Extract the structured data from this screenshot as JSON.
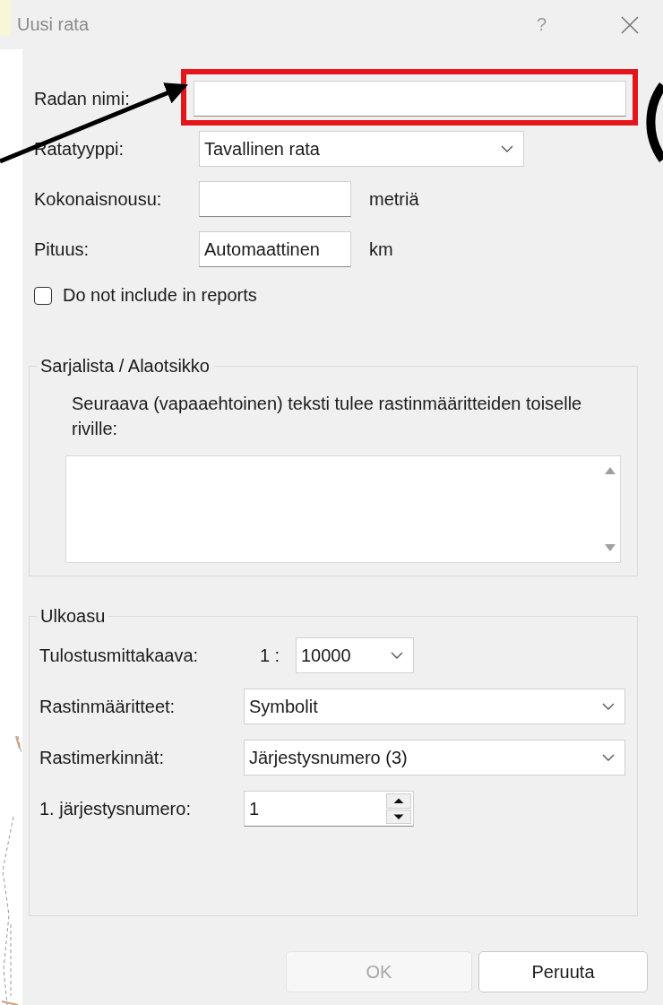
{
  "window": {
    "title": "Uusi rata",
    "help": "?"
  },
  "fields": [
    {
      "kind": "text",
      "label": "Radan nimi:",
      "highlighted": true
    },
    {
      "kind": "dropdown",
      "label": "Ratatyyppi:",
      "value": "Tavallinen rata",
      "highlighted": false
    },
    {
      "kind": "text",
      "label": "Kokonaisnousu:",
      "unit": "metriä",
      "highlighted": false
    },
    {
      "kind": "text",
      "label": "Pituus:",
      "value": "Automaattinen",
      "unit": "km",
      "highlighted": false
    }
  ],
  "exclude_checkbox": {
    "label": "Do not include in reports",
    "checked": false
  },
  "subtitle_group": {
    "title": "Sarjalista / Alaotsikko",
    "description": "Seuraava (vapaaehtoinen) teksti tulee rastinmääritteiden toiselle riville:"
  },
  "layout_group": {
    "title": "Ulkoasu",
    "rows": [
      {
        "kind": "scale",
        "label": "Tulostusmittakaava:",
        "prefix": "1 :",
        "value": "10000"
      },
      {
        "kind": "dropdown",
        "label": "Rastinmääritteet:",
        "value": "Symbolit"
      },
      {
        "kind": "dropdown",
        "label": "Rastimerkinnät:",
        "value": "Järjestysnumero (3)"
      },
      {
        "kind": "spin",
        "label": "1. järjestysnumero:",
        "value": "1"
      }
    ]
  },
  "buttons": [
    {
      "label": "OK",
      "disabled": true
    },
    {
      "label": "Peruuta",
      "disabled": false
    }
  ]
}
